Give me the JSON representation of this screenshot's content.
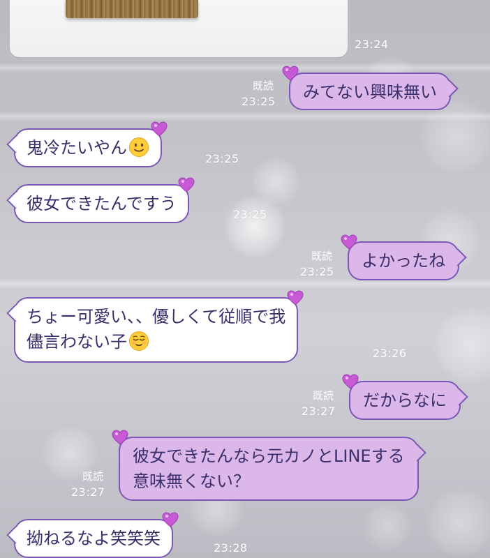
{
  "chat": {
    "messages": [
      {
        "side": "in",
        "kind": "image",
        "time": "23:24"
      },
      {
        "side": "out",
        "text": "みてない興味無い",
        "read": "既読",
        "time": "23:25"
      },
      {
        "side": "in",
        "text": "鬼冷たいやん",
        "emoji": "slightly-smiling-face",
        "time": "23:25"
      },
      {
        "side": "in",
        "text": "彼女できたんですう",
        "time": "23:25"
      },
      {
        "side": "out",
        "text": "よかったね",
        "read": "既読",
        "time": "23:25"
      },
      {
        "side": "in",
        "lines": [
          "ちょー可愛い、、優しくて従順で我",
          "儘言わない子"
        ],
        "emoji": "relieved-face",
        "time": "23:26"
      },
      {
        "side": "out",
        "text": "だからなに",
        "read": "既読",
        "time": "23:27"
      },
      {
        "side": "out",
        "lines": [
          "彼女できたんなら元カノとLINEする",
          "意味無くない？"
        ],
        "read": "既読",
        "time": "23:27"
      },
      {
        "side": "in",
        "text": "拗ねるなよ笑笑笑",
        "time": "23:28"
      }
    ]
  },
  "colors": {
    "bubble_border": "#7b58b8",
    "outgoing_fill": "#dcb8ea",
    "incoming_fill": "#ffffff",
    "text": "#3a2e6b",
    "heart": "#c85ad6"
  },
  "icons": {
    "bubble_decoration": "pink-heart-icon",
    "emoji_1": "slightly-smiling-face-emoji",
    "emoji_2": "relieved-face-emoji"
  }
}
